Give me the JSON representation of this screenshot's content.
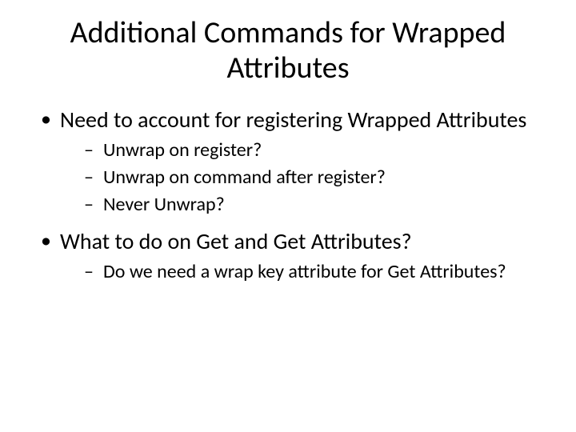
{
  "title": "Additional Commands for Wrapped Attributes",
  "bullets": [
    {
      "text": "Need to account for registering Wrapped Attributes",
      "children": [
        "Unwrap on register?",
        "Unwrap on command after register?",
        "Never Unwrap?"
      ]
    },
    {
      "text": "What to do on Get and Get Attributes?",
      "children": [
        "Do we need a wrap key attribute for Get Attributes?"
      ]
    }
  ]
}
